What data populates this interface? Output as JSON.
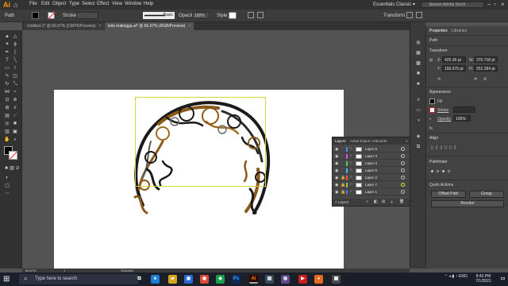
{
  "menubar": {
    "logo": "Ai",
    "items": [
      "File",
      "Edit",
      "Object",
      "Type",
      "Select",
      "Effect",
      "View",
      "Window",
      "Help"
    ],
    "workspace": "Essentials Classic ▾",
    "search_placeholder": "Search Adobe Stock"
  },
  "control_bar": {
    "selection_label": "Path",
    "stroke_label": "Stroke:",
    "brush_label": "Basic",
    "opacity_label": "Opacity:",
    "opacity_value": "100%",
    "style_label": "Style:",
    "transform_label": "Transform"
  },
  "tabs": [
    {
      "label": "Untitled-1* @ 66.67% (CMYK/Preview)",
      "active": false
    },
    {
      "label": "leila malingga.ai* @ 66.67% (RGB/Preview)",
      "active": true
    }
  ],
  "properties": {
    "tabs": [
      "Properties",
      "Libraries"
    ],
    "selection": "Path",
    "transform_title": "Transform",
    "x_label": "X:",
    "x_value": "425.36 pt",
    "y_label": "Y:",
    "y_value": "156.675 pt",
    "w_label": "W:",
    "w_value": "376.718 pt",
    "h_label": "H:",
    "h_value": "252.284 pt",
    "appearance_title": "Appearance",
    "fill_label": "Fill",
    "stroke_label": "Stroke",
    "opacity_label": "Opacity",
    "opacity_value": "100%",
    "fx_label": "fx.",
    "align_title": "Align",
    "pathfinder_title": "Pathfinder",
    "quick_actions_title": "Quick Actions",
    "offset_path": "Offset Path",
    "group": "Group",
    "recolor": "Recolor"
  },
  "layers": {
    "tabs": [
      "Layers",
      "Asset Export",
      "Artboards"
    ],
    "rows": [
      {
        "name": "Layer 6",
        "color": "#4f8cff"
      },
      {
        "name": "Layer 3",
        "color": "#d04fff"
      },
      {
        "name": "Layer 4",
        "color": "#58d058"
      },
      {
        "name": "Layer 5",
        "color": "#4fb0ff"
      },
      {
        "name": "Layer 2",
        "color": "#ff4f4f"
      },
      {
        "name": "Layer 7",
        "color": "#9fbf4f"
      },
      {
        "name": "Layer 1",
        "color": "#4f6fff"
      }
    ],
    "count": "7 Layers"
  },
  "status": {
    "zoom": "66.67%",
    "artboard": "1",
    "tool": "Selection"
  },
  "taskbar": {
    "search_placeholder": "Type here to search",
    "lang": "ENG",
    "time": "8:43 PM",
    "date": "7/1/2021"
  }
}
